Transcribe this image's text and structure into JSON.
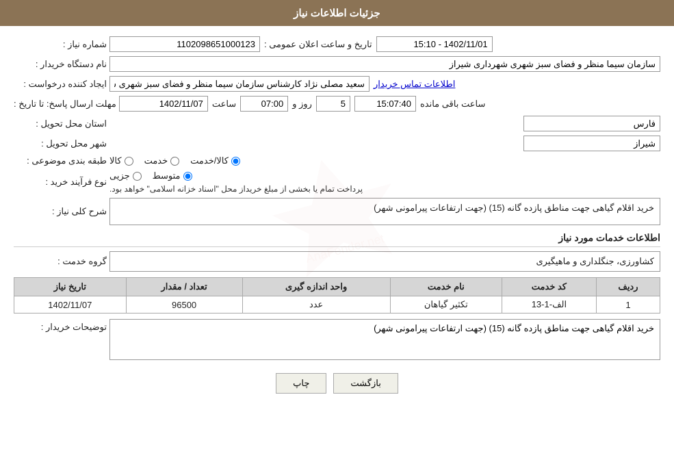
{
  "header": {
    "title": "جزئیات اطلاعات نیاز"
  },
  "fields": {
    "need_number_label": "شماره نیاز :",
    "need_number_value": "1102098651000123",
    "announcement_date_label": "تاریخ و ساعت اعلان عمومی :",
    "announcement_date_value": "1402/11/01 - 15:10",
    "buyer_org_label": "نام دستگاه خریدار :",
    "buyer_org_value": "سازمان سیما منظر و فضای سبز شهری شهرداری شیراز",
    "creator_label": "ایجاد کننده درخواست :",
    "creator_value": "سعید مصلی نژاد کارشناس سازمان سیما منظر و فضای سبز شهری شهرداری ش",
    "creator_link": "اطلاعات تماس خریدار",
    "deadline_label": "مهلت ارسال پاسخ: تا تاریخ :",
    "deadline_date": "1402/11/07",
    "deadline_time_label": "ساعت",
    "deadline_time": "07:00",
    "deadline_day_label": "روز و",
    "deadline_days": "5",
    "deadline_remaining_label": "ساعت باقی مانده",
    "deadline_remaining": "15:07:40",
    "province_label": "استان محل تحویل :",
    "province_value": "فارس",
    "city_label": "شهر محل تحویل :",
    "city_value": "شیراز",
    "category_label": "طبقه بندی موضوعی :",
    "category_goods": "کالا",
    "category_service": "خدمت",
    "category_goods_service": "کالا/خدمت",
    "process_label": "نوع فرآیند خرید :",
    "process_partial": "جزیی",
    "process_medium": "متوسط",
    "process_notice": "پرداخت تمام یا بخشی از مبلغ خریداز محل \"اسناد خزانه اسلامی\" خواهد بود.",
    "need_description_label": "شرح کلی نیاز :",
    "need_description": "خرید اقلام گیاهی جهت مناطق پازده گانه (15) (جهت ارتفاعات پیرامونی شهر)",
    "service_info_title": "اطلاعات خدمات مورد نیاز",
    "service_group_label": "گروه خدمت :",
    "service_group_value": "کشاورزی، جنگلداری و ماهیگیری",
    "table": {
      "headers": [
        "ردیف",
        "کد خدمت",
        "نام خدمت",
        "واحد اندازه گیری",
        "تعداد / مقدار",
        "تاریخ نیاز"
      ],
      "rows": [
        {
          "row": "1",
          "code": "الف-1-13",
          "name": "تکثیر گیاهان",
          "unit": "عدد",
          "quantity": "96500",
          "date": "1402/11/07"
        }
      ]
    },
    "buyer_desc_label": "توضیحات خریدار :",
    "buyer_desc_value": "خرید اقلام گیاهی جهت مناطق پازده گانه (15) (جهت ارتفاعات پیرامونی شهر)"
  },
  "buttons": {
    "print": "چاپ",
    "back": "بازگشت"
  }
}
